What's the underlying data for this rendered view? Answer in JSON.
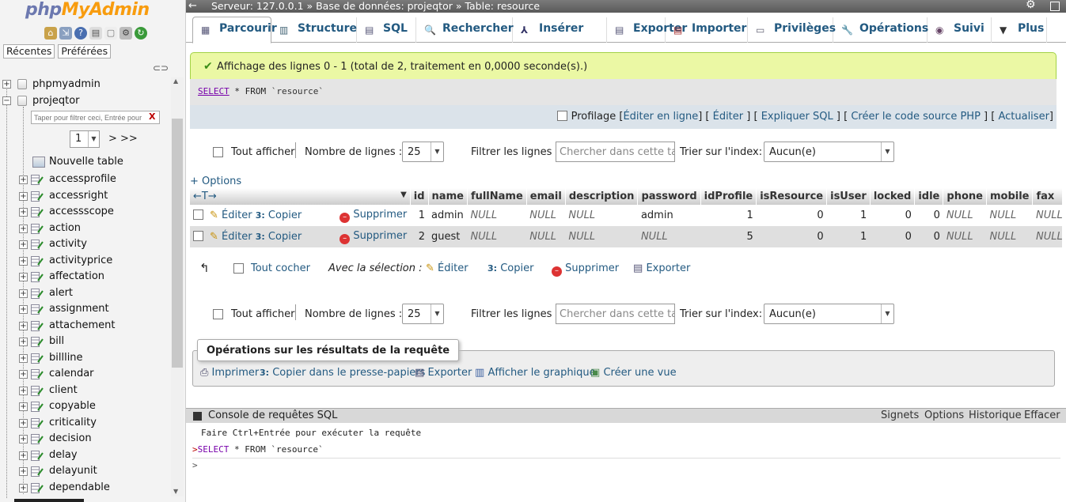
{
  "nav": {
    "logo_php": "php",
    "logo_my": "MyAdmin",
    "tab_recent": "Récentes",
    "tab_favorites": "Préférées",
    "filter_placeholder": "Taper pour filtrer ceci, Entrée pour",
    "page_value": "1",
    "page_next": "> >>",
    "databases": [
      "phpmyadmin",
      "projeqtor"
    ],
    "new_table": "Nouvelle table",
    "tables": [
      "accessprofile",
      "accessright",
      "accessscope",
      "action",
      "activity",
      "activityprice",
      "affectation",
      "alert",
      "assignment",
      "attachement",
      "bill",
      "billline",
      "calendar",
      "client",
      "copyable",
      "criticality",
      "decision",
      "delay",
      "delayunit",
      "dependable"
    ]
  },
  "topbar": {
    "breadcrumb": "Serveur: 127.0.0.1 » Base de données: projeqtor » Table: resource"
  },
  "tabs": [
    "Parcourir",
    "Structure",
    "SQL",
    "Rechercher",
    "Insérer",
    "Exporter",
    "Importer",
    "Privilèges",
    "Opérations",
    "Suivi",
    "Plus"
  ],
  "message": {
    "success": "Affichage des lignes 0 - 1 (total de 2, traitement en 0,0000 seconde(s).)",
    "sql_select": "SELECT",
    "sql_rest": " * FROM ",
    "sql_table": "`resource`"
  },
  "sqltools": {
    "profiling": "Profilage",
    "inline_edit": "Éditer en ligne",
    "edit": "Éditer",
    "explain": "Expliquer SQL",
    "php_code": "Créer le code source PHP",
    "refresh": "Actualiser"
  },
  "navbar": {
    "show_all": "Tout afficher",
    "rows_label": "Nombre de lignes :",
    "rows_value": "25",
    "filter_label": "Filtrer les lignes :",
    "filter_placeholder": "Chercher dans cette table",
    "sort_label": "Trier sur l'index:",
    "sort_value": "Aucun(e)"
  },
  "results": {
    "options": "+ Options",
    "columns": [
      "id",
      "name",
      "fullName",
      "email",
      "description",
      "password",
      "idProfile",
      "isResource",
      "isUser",
      "locked",
      "idle",
      "phone",
      "mobile",
      "fax"
    ],
    "action_edit": "Éditer",
    "action_copy": "Copier",
    "action_delete": "Supprimer",
    "rows": [
      [
        "1",
        "admin",
        "NULL",
        "NULL",
        "NULL",
        "admin",
        "1",
        "0",
        "1",
        "0",
        "0",
        "NULL",
        "NULL",
        "NULL"
      ],
      [
        "2",
        "guest",
        "NULL",
        "NULL",
        "NULL",
        "NULL",
        "5",
        "0",
        "1",
        "0",
        "0",
        "NULL",
        "NULL",
        "NULL"
      ]
    ]
  },
  "with_selection": {
    "check_all": "Tout cocher",
    "label": "Avec la sélection :",
    "edit": "Éditer",
    "copy": "Copier",
    "delete": "Supprimer",
    "export": "Exporter"
  },
  "query_ops": {
    "legend": "Opérations sur les résultats de la requête",
    "print": "Imprimer",
    "copy_clipboard": "Copier dans le presse-papiers",
    "export": "Exporter",
    "chart": "Afficher le graphique",
    "view": "Créer une vue"
  },
  "console": {
    "title": "Console de requêtes SQL",
    "bookmarks": "Signets",
    "options": "Options",
    "history": "Historique",
    "clear": "Effacer",
    "hint": "Faire Ctrl+Entrée pour exécuter la requête",
    "prompt": ">",
    "last_select": "SELECT",
    "last_rest": " * FROM ",
    "last_table": "`resource`"
  }
}
